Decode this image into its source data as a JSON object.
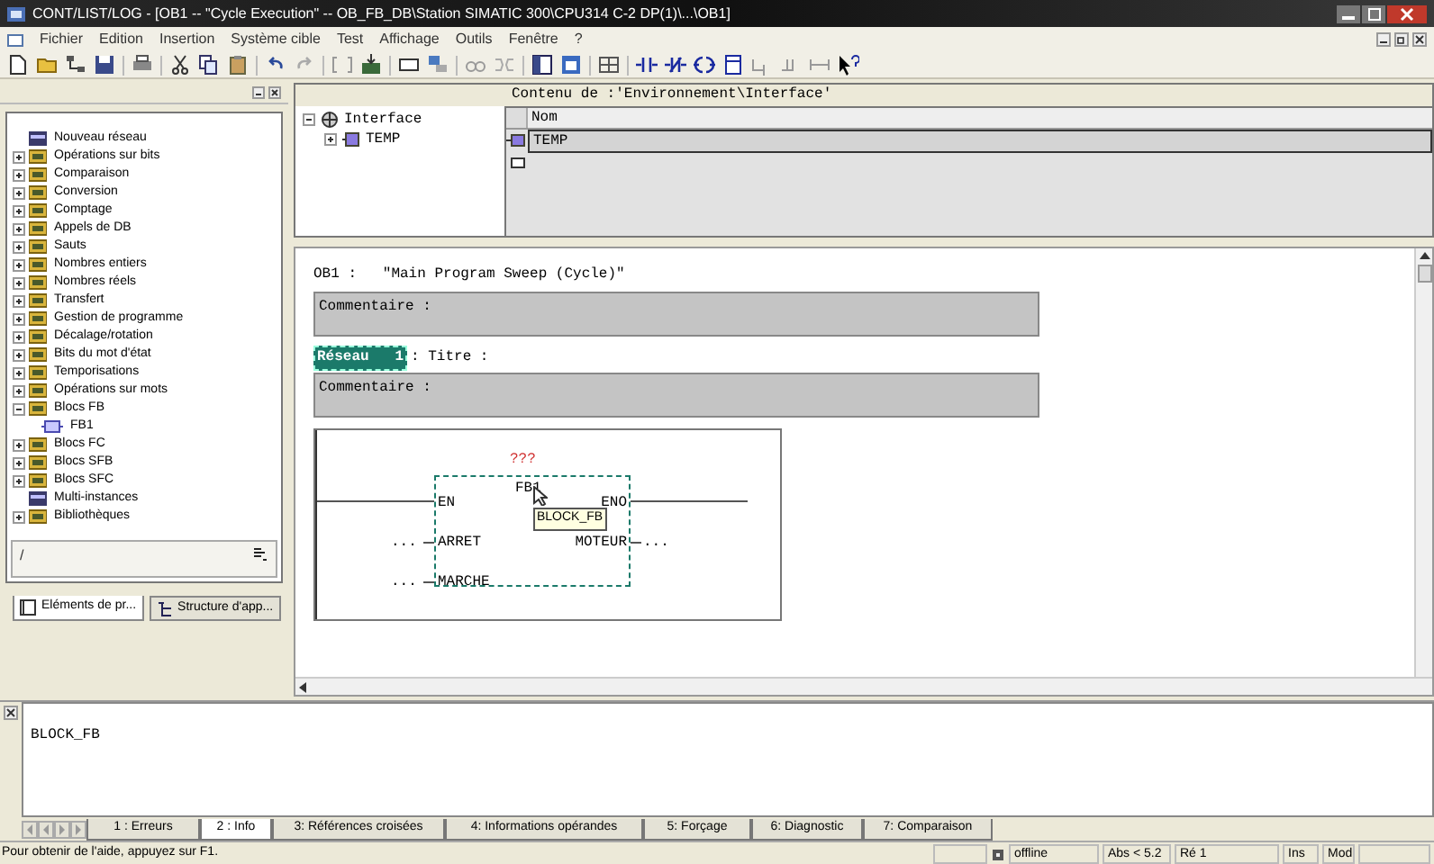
{
  "window": {
    "title": "CONT/LIST/LOG - [OB1 -- \"Cycle Execution\" -- OB_FB_DB\\Station SIMATIC 300\\CPU314 C-2 DP(1)\\...\\OB1]"
  },
  "menu": [
    "Fichier",
    "Edition",
    "Insertion",
    "Système cible",
    "Test",
    "Affichage",
    "Outils",
    "Fenêtre",
    "?"
  ],
  "catalog": {
    "items": [
      {
        "label": "Nouveau réseau",
        "kind": "leaf"
      },
      {
        "label": "Opérations sur bits",
        "kind": "folder",
        "expanded": false
      },
      {
        "label": "Comparaison",
        "kind": "folder",
        "expanded": false
      },
      {
        "label": "Conversion",
        "kind": "folder",
        "expanded": false
      },
      {
        "label": "Comptage",
        "kind": "folder",
        "expanded": false
      },
      {
        "label": "Appels de DB",
        "kind": "folder",
        "expanded": false
      },
      {
        "label": "Sauts",
        "kind": "folder",
        "expanded": false
      },
      {
        "label": "Nombres entiers",
        "kind": "folder",
        "expanded": false
      },
      {
        "label": "Nombres réels",
        "kind": "folder",
        "expanded": false
      },
      {
        "label": "Transfert",
        "kind": "folder",
        "expanded": false
      },
      {
        "label": "Gestion de programme",
        "kind": "folder",
        "expanded": false
      },
      {
        "label": "Décalage/rotation",
        "kind": "folder",
        "expanded": false
      },
      {
        "label": "Bits du mot d'état",
        "kind": "folder",
        "expanded": false
      },
      {
        "label": "Temporisations",
        "kind": "folder",
        "expanded": false
      },
      {
        "label": "Opérations sur mots",
        "kind": "folder",
        "expanded": false
      },
      {
        "label": "Blocs FB",
        "kind": "folder",
        "expanded": true,
        "children": [
          {
            "label": "FB1",
            "kind": "block"
          }
        ]
      },
      {
        "label": "Blocs FC",
        "kind": "folder",
        "expanded": false
      },
      {
        "label": "Blocs SFB",
        "kind": "folder",
        "expanded": false
      },
      {
        "label": "Blocs SFC",
        "kind": "folder",
        "expanded": false
      },
      {
        "label": "Multi-instances",
        "kind": "leaf"
      },
      {
        "label": "Bibliothèques",
        "kind": "folder",
        "expanded": false
      }
    ],
    "path": "/",
    "tabs": [
      {
        "label": "Eléments de pr...",
        "selected": true
      },
      {
        "label": "Structure d'app...",
        "selected": false
      }
    ]
  },
  "interface": {
    "tree": [
      {
        "label": "Interface",
        "expanded": true,
        "children": [
          {
            "label": "TEMP",
            "expanded": false
          }
        ]
      }
    ],
    "content_title": "Contenu de :'Environnement\\Interface'",
    "columns": [
      "Nom"
    ],
    "rows": [
      {
        "name": "TEMP",
        "selected": true
      }
    ]
  },
  "editor": {
    "block_title": "OB1 :   \"Main Program Sweep (Cycle)\"",
    "comment": "Commentaire :",
    "network": {
      "label": "Réseau   1",
      "title": ": Titre :",
      "comment": "Commentaire :"
    },
    "fbd": {
      "instance": "???",
      "block": "FB1",
      "tooltip": "BLOCK_FB",
      "inputs": [
        {
          "pin": "EN"
        },
        {
          "pin": "ARRET",
          "wire": "..."
        },
        {
          "pin": "MARCHE",
          "wire": "..."
        }
      ],
      "outputs": [
        {
          "pin": "ENO"
        },
        {
          "pin": "MOTEUR",
          "wire": "..."
        }
      ]
    }
  },
  "output": {
    "text": "BLOCK_FB",
    "tabs": [
      {
        "label": "1 : Erreurs",
        "selected": false
      },
      {
        "label": "2 : Info",
        "selected": true
      },
      {
        "label": "3: Références croisées",
        "selected": false
      },
      {
        "label": "4: Informations opérandes",
        "selected": false
      },
      {
        "label": "5: Forçage",
        "selected": false
      },
      {
        "label": "6: Diagnostic",
        "selected": false
      },
      {
        "label": "7: Comparaison",
        "selected": false
      }
    ]
  },
  "status_bar": {
    "help": "Pour obtenir de l'aide, appuyez sur F1.",
    "mode": "offline",
    "abs": "Abs < 5.2",
    "row": "Ré 1",
    "ins": "Ins",
    "mod": "Mod"
  }
}
